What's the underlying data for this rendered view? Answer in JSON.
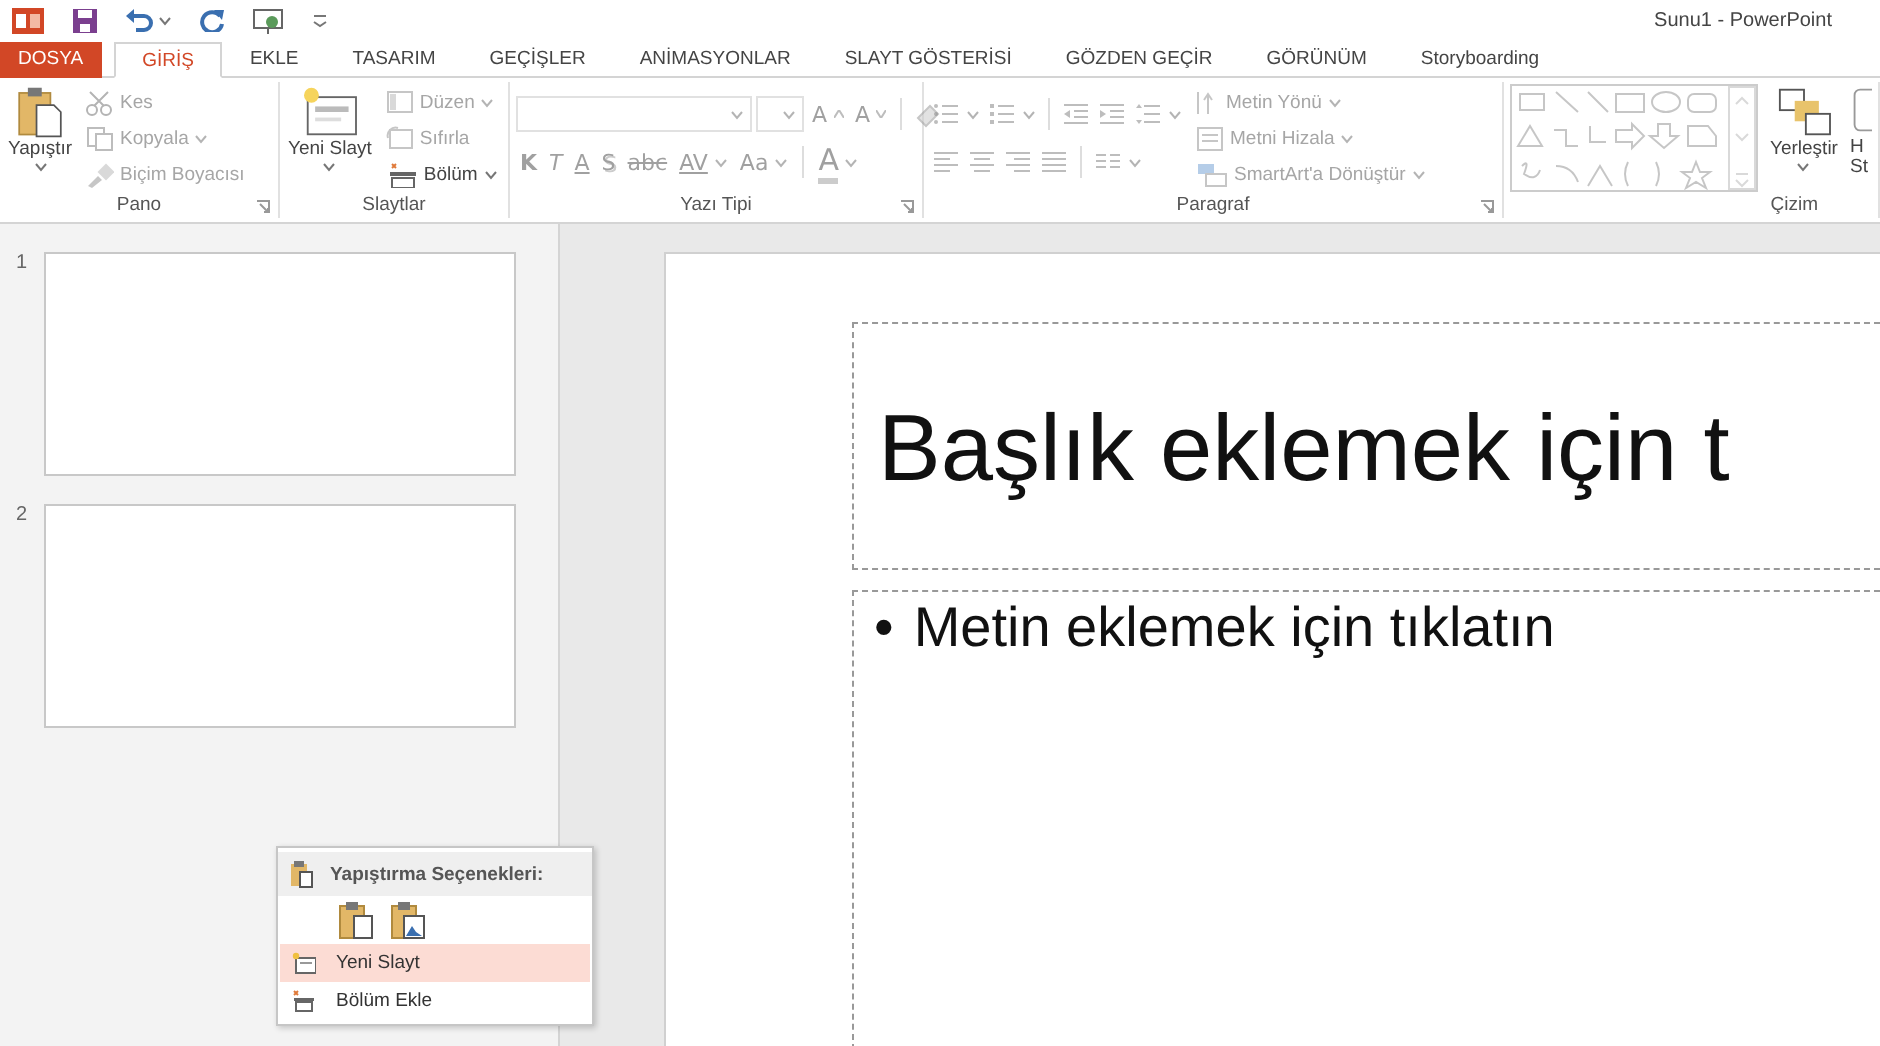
{
  "title_bar": {
    "title": "Sunu1 - PowerPoint",
    "quick_access": [
      {
        "kind": "logo"
      },
      {
        "kind": "save"
      },
      {
        "kind": "undo",
        "dropdown": true
      },
      {
        "kind": "redo"
      },
      {
        "kind": "slideshow"
      },
      {
        "kind": "customize"
      }
    ]
  },
  "tabs": [
    {
      "label": "DOSYA",
      "kind": "file",
      "selected": false
    },
    {
      "label": "GİRİŞ",
      "kind": "tab",
      "selected": true
    },
    {
      "label": "EKLE",
      "kind": "tab",
      "selected": false
    },
    {
      "label": "TASARIM",
      "kind": "tab",
      "selected": false
    },
    {
      "label": "GEÇİŞLER",
      "kind": "tab",
      "selected": false
    },
    {
      "label": "ANİMASYONLAR",
      "kind": "tab",
      "selected": false
    },
    {
      "label": "SLAYT GÖSTERİSİ",
      "kind": "tab",
      "selected": false
    },
    {
      "label": "GÖZDEN GEÇİR",
      "kind": "tab",
      "selected": false
    },
    {
      "label": "GÖRÜNÜM",
      "kind": "tab",
      "selected": false
    },
    {
      "label": "Storyboarding",
      "kind": "tab",
      "selected": false
    }
  ],
  "ribbon": {
    "groups": [
      {
        "label": "Pano",
        "launcher": true,
        "columns": [
          [
            [
              {
                "kind": "large",
                "label": "Yapıştır",
                "dropdown": true,
                "disabled": false
              }
            ]
          ],
          [
            [
              {
                "kind": "small",
                "label": "Kes",
                "dropdown": false,
                "disabled": true
              }
            ],
            [
              {
                "kind": "small",
                "label": "Kopyala",
                "dropdown": true,
                "disabled": true
              }
            ],
            [
              {
                "kind": "small",
                "label": "Biçim Boyacısı",
                "dropdown": false,
                "disabled": true
              }
            ]
          ]
        ]
      },
      {
        "label": "Slaytlar",
        "launcher": false,
        "columns": [
          [
            [
              {
                "kind": "large",
                "label": "Yeni Slayt",
                "dropdown": true,
                "disabled": false
              }
            ]
          ],
          [
            [
              {
                "kind": "small",
                "label": "Düzen",
                "dropdown": true,
                "disabled": true
              }
            ],
            [
              {
                "kind": "small",
                "label": "Sıfırla",
                "dropdown": false,
                "disabled": true
              }
            ],
            [
              {
                "kind": "small",
                "label": "Bölüm",
                "dropdown": true,
                "disabled": false
              }
            ]
          ]
        ]
      },
      {
        "label": "Yazı Tipi",
        "launcher": true,
        "columns": [
          [
            [
              {
                "kind": "combo",
                "disabled": true
              },
              {
                "kind": "combo",
                "disabled": true
              },
              {
                "kind": "text",
                "label": "A",
                "dropdown": false,
                "disabled": true
              },
              {
                "kind": "text",
                "label": "A",
                "dropdown": false,
                "disabled": true
              },
              {
                "kind": "separator"
              },
              {
                "kind": "icon",
                "dropdown": false,
                "disabled": true
              }
            ],
            [
              {
                "kind": "text",
                "label": "K",
                "dropdown": false,
                "disabled": true
              },
              {
                "kind": "text",
                "label": "T",
                "dropdown": false,
                "disabled": true
              },
              {
                "kind": "text",
                "label": "A",
                "dropdown": false,
                "disabled": true
              },
              {
                "kind": "text",
                "label": "S",
                "dropdown": false,
                "disabled": true
              },
              {
                "kind": "text",
                "label": "abc",
                "dropdown": false,
                "disabled": true
              },
              {
                "kind": "text",
                "label": "AV",
                "dropdown": true,
                "disabled": true
              },
              {
                "kind": "text",
                "label": "Aa",
                "dropdown": true,
                "disabled": true
              },
              {
                "kind": "separator"
              },
              {
                "kind": "text",
                "label": "A",
                "dropdown": true,
                "disabled": true
              }
            ]
          ]
        ]
      },
      {
        "label": "Paragraf",
        "launcher": true,
        "columns": [
          [
            [
              {
                "kind": "icon",
                "dropdown": true,
                "disabled": true
              },
              {
                "kind": "icon",
                "dropdown": true,
                "disabled": true
              },
              {
                "kind": "separator"
              },
              {
                "kind": "icon",
                "dropdown": false,
                "disabled": true
              },
              {
                "kind": "icon",
                "dropdown": false,
                "disabled": true
              },
              {
                "kind": "icon",
                "dropdown": true,
                "disabled": true
              }
            ],
            [
              {
                "kind": "icon",
                "dropdown": false,
                "disabled": true
              },
              {
                "kind": "icon",
                "dropdown": false,
                "disabled": true
              },
              {
                "kind": "icon",
                "dropdown": false,
                "disabled": true
              },
              {
                "kind": "icon",
                "dropdown": false,
                "disabled": true
              },
              {
                "kind": "separator"
              },
              {
                "kind": "icon",
                "dropdown": true,
                "disabled": true
              }
            ]
          ],
          [
            [
              {
                "kind": "small",
                "label": "Metin Yönü",
                "dropdown": true,
                "disabled": true
              }
            ],
            [
              {
                "kind": "small",
                "label": "Metni Hizala",
                "dropdown": true,
                "disabled": true
              }
            ],
            [
              {
                "kind": "small",
                "label": "SmartArt'a Dönüştür",
                "dropdown": true,
                "disabled": true
              }
            ]
          ]
        ]
      },
      {
        "label": "Çizim",
        "launcher": false,
        "columns": [
          [
            [
              {
                "kind": "gallery",
                "disabled": true
              }
            ]
          ],
          [
            [
              {
                "kind": "large",
                "label": "Yerleştir",
                "dropdown": true,
                "disabled": false
              }
            ]
          ],
          [
            [
              {
                "kind": "large",
                "label": "H St",
                "dropdown": false,
                "disabled": false
              }
            ]
          ]
        ]
      }
    ]
  },
  "thumbnails": [
    {
      "number": "1"
    },
    {
      "number": "2"
    }
  ],
  "slide": {
    "title_placeholder": "Başlık eklemek için t",
    "bullet": "•",
    "body_placeholder": "Metin eklemek için tıklatın"
  },
  "context_menu": {
    "header": "Yapıştırma Seçenekleri:",
    "paste_options": [
      {
        "kind": "keep"
      },
      {
        "kind": "picture"
      }
    ],
    "items": [
      {
        "label": "Yeni Slayt",
        "selected": true
      },
      {
        "label": "Bölüm Ekle",
        "selected": false
      }
    ]
  }
}
